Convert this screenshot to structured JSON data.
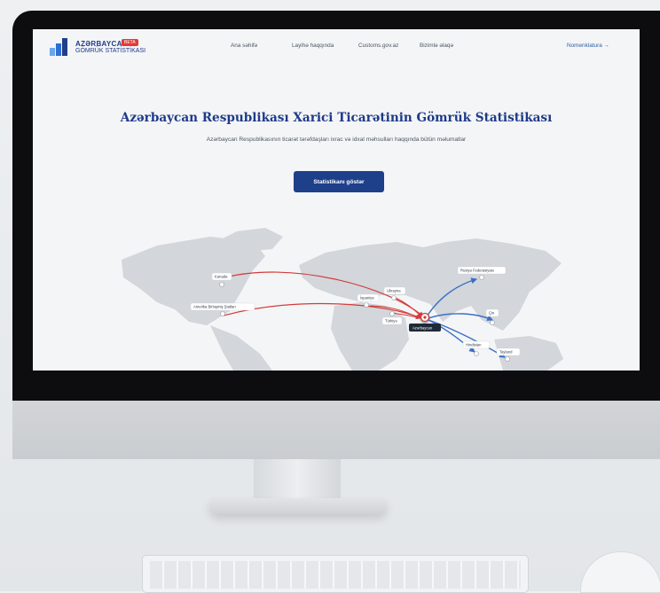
{
  "brand": {
    "line1": "AZƏRBAYCAN",
    "line2": "GÖMRÜK STATİSTİKASI",
    "badge": "BETA"
  },
  "nav": {
    "items": [
      "Ana səhifə",
      "Layihə haqqında",
      "Customs.gov.az",
      "Bizimlə əlaqə"
    ],
    "nomenklatura": "Nomenklatura →"
  },
  "hero": {
    "title": "Azərbaycan Respublikası Xarici Ticarətinin Gömrük Statistikası",
    "subtitle": "Azərbaycan Respublikasının ticarət tərəfdaşları ixrac və idxal məhsulları haqqında bütün məlumatlar",
    "button": "Statistikanı göstər"
  },
  "map": {
    "labels": {
      "kanada": "Kanada",
      "abs": "Amerika Birləşmiş Ştatları",
      "ukrayna": "Ukrayna",
      "ispaniya": "İspaniya",
      "turkiye": "Türkiyə",
      "azerbaycan": "Azərbaycan",
      "rusiya": "Rusiya Federasiyası",
      "cin": "Çin",
      "hindistan": "Hindistan",
      "tayland": "Tayland"
    },
    "colors": {
      "import": "#d33b3b",
      "export": "#3b6fc4",
      "land": "#d2d5d9"
    }
  }
}
